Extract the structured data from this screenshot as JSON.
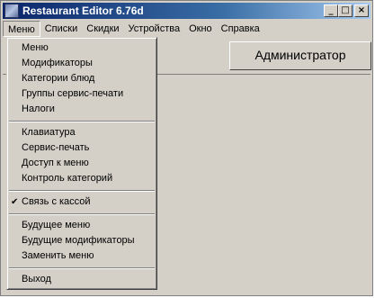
{
  "window": {
    "title": "Restaurant Editor 6.76d",
    "buttons": {
      "minimize": "_",
      "maximize": "□",
      "close": "×"
    }
  },
  "menubar": {
    "items": [
      {
        "label": "Меню"
      },
      {
        "label": "Списки"
      },
      {
        "label": "Скидки"
      },
      {
        "label": "Устройства"
      },
      {
        "label": "Окно"
      },
      {
        "label": "Справка"
      }
    ]
  },
  "toolbar": {
    "user_button_label": "Администратор"
  },
  "dropdown": {
    "groups": [
      {
        "items": [
          {
            "label": "Меню"
          },
          {
            "label": "Модификаторы"
          },
          {
            "label": "Категории блюд"
          },
          {
            "label": "Группы сервис-печати"
          },
          {
            "label": "Налоги"
          }
        ]
      },
      {
        "items": [
          {
            "label": "Клавиатура"
          },
          {
            "label": "Сервис-печать"
          },
          {
            "label": "Доступ к меню"
          },
          {
            "label": "Контроль категорий"
          }
        ]
      },
      {
        "items": [
          {
            "label": "Связь с кассой",
            "checked": true,
            "check_glyph": "✔"
          }
        ]
      },
      {
        "items": [
          {
            "label": "Будущее меню"
          },
          {
            "label": "Будущие модификаторы"
          },
          {
            "label": "Заменить меню"
          }
        ]
      },
      {
        "items": [
          {
            "label": "Выход"
          }
        ]
      }
    ]
  }
}
